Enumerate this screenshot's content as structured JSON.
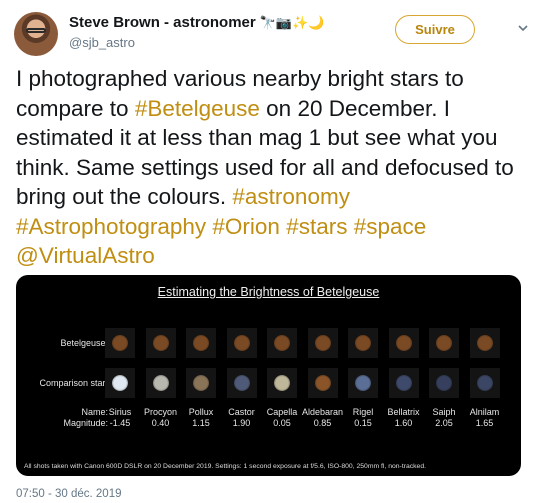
{
  "author": {
    "name": "Steve Brown - astronomer",
    "emoji": "🔭📷✨🌙",
    "handle": "@sjb_astro"
  },
  "follow_label": "Suivre",
  "tweet_segments": [
    {
      "text": "I photographed various nearby bright stars to compare to ",
      "tag": false
    },
    {
      "text": "#Betelgeuse",
      "tag": true
    },
    {
      "text": " on 20 December. I estimated it at less than mag 1 but see what you think. Same settings used for all and defocused to bring out the colours. ",
      "tag": false
    },
    {
      "text": "#astronomy",
      "tag": true
    },
    {
      "text": " ",
      "tag": false
    },
    {
      "text": "#Astrophotography",
      "tag": true
    },
    {
      "text": " ",
      "tag": false
    },
    {
      "text": "#Orion",
      "tag": true
    },
    {
      "text": " ",
      "tag": false
    },
    {
      "text": "#stars",
      "tag": true
    },
    {
      "text": " ",
      "tag": false
    },
    {
      "text": "#space",
      "tag": true
    },
    {
      "text": " ",
      "tag": false
    },
    {
      "text": "@VirtualAstro",
      "tag": true
    }
  ],
  "image": {
    "title": "Estimating the Brightness of Betelgeuse",
    "row_labels": {
      "betelgeuse": "Betelgeuse:",
      "comparison": "Comparison star:",
      "name": "Name:",
      "magnitude": "Magnitude:"
    },
    "betelgeuse_color": "#7a4a24",
    "stars": [
      {
        "name": "Sirius",
        "magnitude": "-1.45",
        "color": "#dfe8f0"
      },
      {
        "name": "Procyon",
        "magnitude": "0.40",
        "color": "#b8b8ae"
      },
      {
        "name": "Pollux",
        "magnitude": "1.15",
        "color": "#8a7458"
      },
      {
        "name": "Castor",
        "magnitude": "1.90",
        "color": "#4e5a78"
      },
      {
        "name": "Capella",
        "magnitude": "0.05",
        "color": "#bfb79a"
      },
      {
        "name": "Aldebaran",
        "magnitude": "0.85",
        "color": "#8a5428"
      },
      {
        "name": "Rigel",
        "magnitude": "0.15",
        "color": "#5a6e96"
      },
      {
        "name": "Bellatrix",
        "magnitude": "1.60",
        "color": "#3e4a6c"
      },
      {
        "name": "Saiph",
        "magnitude": "2.05",
        "color": "#36405e"
      },
      {
        "name": "Alnilam",
        "magnitude": "1.65",
        "color": "#3a4664"
      }
    ],
    "footnote": "All shots taken with Canon 600D DSLR on 20 December 2019. Settings: 1 second exposure at f/5.6, ISO-800, 250mm fl, non-tracked."
  },
  "timestamp": "07:50 - 30 déc. 2019"
}
